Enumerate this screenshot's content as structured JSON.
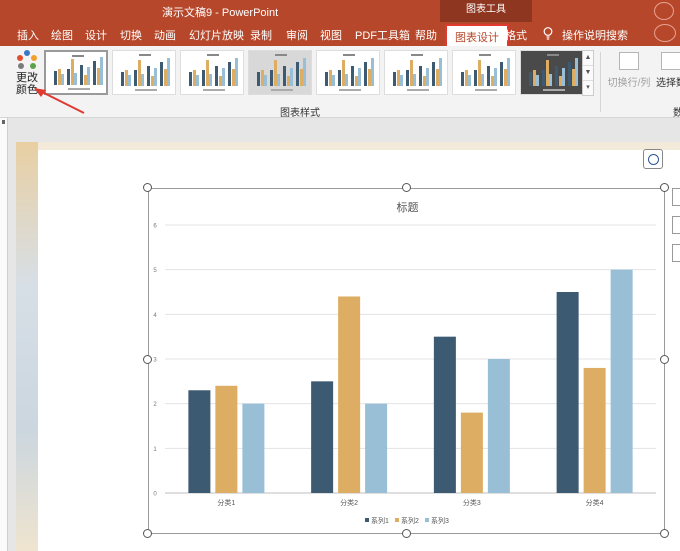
{
  "window": {
    "doc_title": "演示文稿9 - PowerPoint",
    "contextual_tools": "图表工具"
  },
  "tabs": [
    "插入",
    "绘图",
    "设计",
    "切换",
    "动画",
    "幻灯片放映",
    "录制",
    "审阅",
    "视图",
    "PDF工具箱",
    "帮助",
    "图表设计",
    "格式"
  ],
  "active_tab": "图表设计",
  "tell_me": "操作说明搜索",
  "ribbon": {
    "change_colors_line1": "更改",
    "change_colors_line2": "颜色",
    "styles_group_label": "图表样式",
    "switch_row_col": "切换行/列",
    "select_data": "选择数",
    "data_group_label": "数"
  },
  "colors": {
    "accent": "#b7472a",
    "series1": "#3d5a73",
    "series2": "#dcad62",
    "series3": "#99bfd6",
    "highlight": "#e03a30"
  },
  "chart_data": {
    "type": "bar",
    "title": "标题",
    "categories": [
      "分类1",
      "分类2",
      "分类3",
      "分类4"
    ],
    "series": [
      {
        "name": "系列1",
        "values": [
          2.3,
          2.5,
          3.5,
          4.5
        ]
      },
      {
        "name": "系列2",
        "values": [
          2.4,
          4.4,
          1.8,
          2.8
        ]
      },
      {
        "name": "系列3",
        "values": [
          2,
          2,
          3,
          5
        ]
      }
    ],
    "yticks": [
      "0",
      "1",
      "2",
      "3",
      "4",
      "5",
      "6"
    ],
    "ylim": [
      0,
      6
    ],
    "grid": true,
    "legend": "bottom"
  }
}
